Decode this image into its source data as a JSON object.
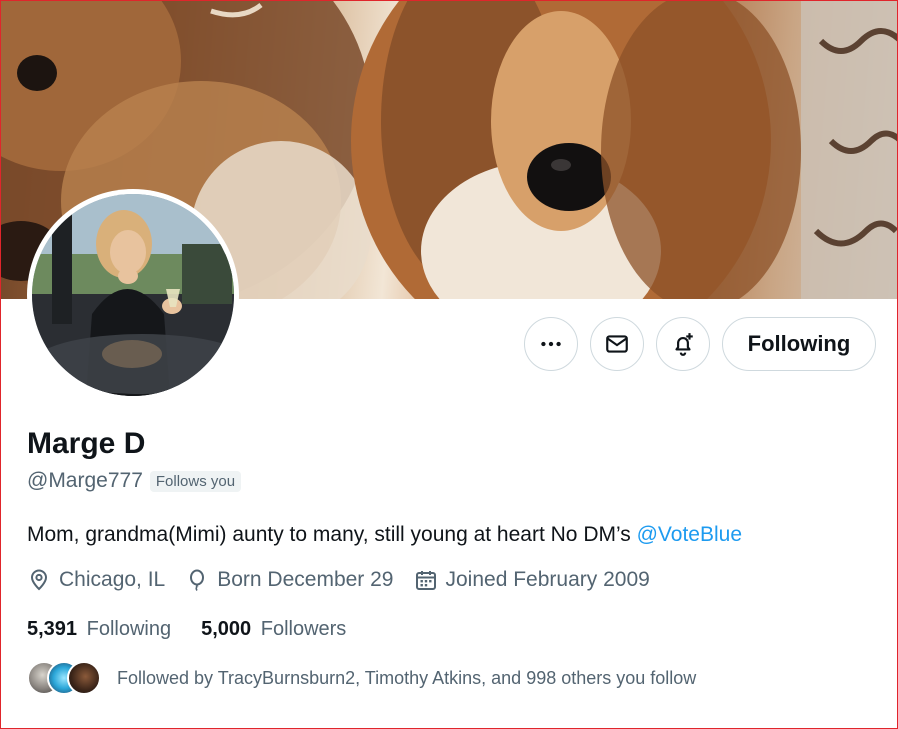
{
  "profile": {
    "name": "Marge D",
    "handle": "@Marge777",
    "follows_you_badge": "Follows you",
    "bio_text": "Mom, grandma(Mimi) aunty to many, still young at heart No DM’s ",
    "bio_mention": "@VoteBlue",
    "location": "Chicago, IL",
    "birthday": "Born December 29",
    "joined": "Joined February 2009",
    "following_count": "5,391",
    "following_label": "Following",
    "followers_count": "5,000",
    "followers_label": "Followers",
    "followed_by_text": "Followed by TracyBurnsburn2, Timothy Atkins, and 998 others you follow"
  },
  "actions": {
    "more_icon": "more-horizontal-icon",
    "message_icon": "envelope-icon",
    "notify_icon": "bell-plus-icon",
    "follow_button_label": "Following"
  },
  "colors": {
    "accent_link": "#1d9bf0",
    "secondary_text": "#536471",
    "primary_text": "#0f1419",
    "border": "#cfd9de",
    "window_border": "#e0252b"
  }
}
